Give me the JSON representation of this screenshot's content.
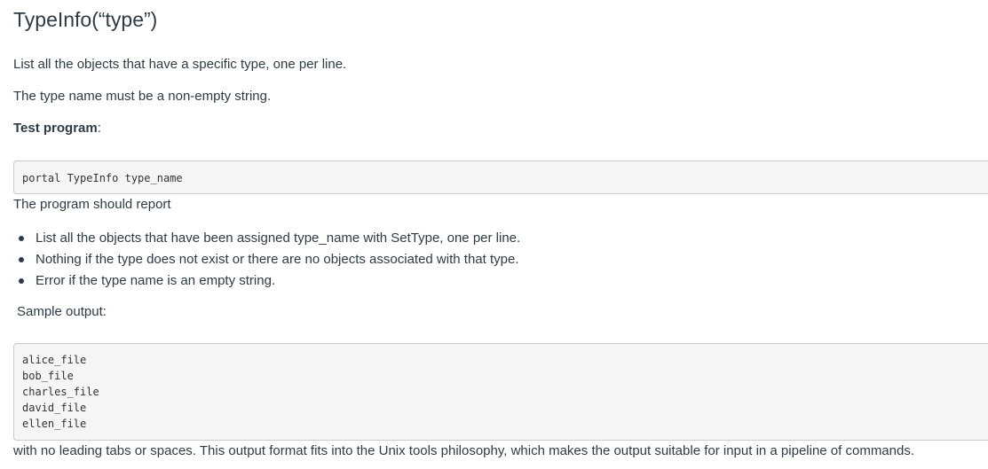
{
  "heading": "TypeInfo(“type”)",
  "intro": "List all the objects that have a specific type, one per line.",
  "requirement": "The type name must be a non-empty string.",
  "test_program_label": "Test program",
  "test_program_colon": ":",
  "test_command": "portal TypeInfo type_name",
  "report_intro": "The program should report",
  "report_items": [
    "List all the objects that have been assigned type_name with SetType, one per line.",
    "Nothing if the type does not exist or there are no objects associated with that type.",
    "Error if the type name is an empty string."
  ],
  "sample_label": "Sample output:",
  "sample_output": [
    "alice_file",
    "bob_file",
    "charles_file",
    "david_file",
    "ellen_file"
  ],
  "closing": "with no leading tabs or spaces. This output format fits into the Unix tools philosophy, which makes the output suitable for input in a pipeline of commands."
}
